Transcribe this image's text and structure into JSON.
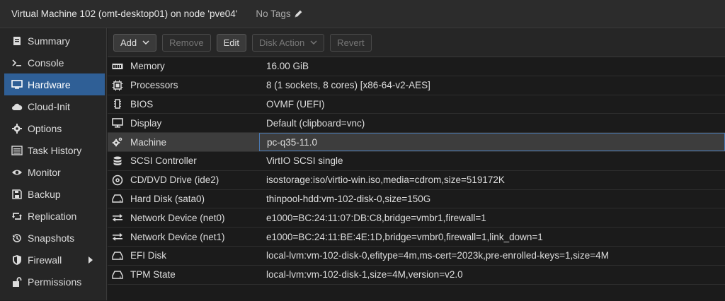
{
  "header": {
    "title": "Virtual Machine 102 (omt-desktop01) on node 'pve04'",
    "tags_label": "No Tags"
  },
  "sidebar": {
    "items": [
      {
        "label": "Summary",
        "icon": "summary-icon"
      },
      {
        "label": "Console",
        "icon": "console-icon"
      },
      {
        "label": "Hardware",
        "icon": "monitor-icon",
        "active": true
      },
      {
        "label": "Cloud-Init",
        "icon": "cloud-icon"
      },
      {
        "label": "Options",
        "icon": "gear-icon"
      },
      {
        "label": "Task History",
        "icon": "list-icon"
      },
      {
        "label": "Monitor",
        "icon": "eye-icon"
      },
      {
        "label": "Backup",
        "icon": "floppy-icon"
      },
      {
        "label": "Replication",
        "icon": "retweet-icon"
      },
      {
        "label": "Snapshots",
        "icon": "history-icon"
      },
      {
        "label": "Firewall",
        "icon": "shield-icon"
      },
      {
        "label": "Permissions",
        "icon": "unlock-icon"
      }
    ]
  },
  "toolbar": {
    "add": "Add",
    "remove": "Remove",
    "edit": "Edit",
    "disk_action": "Disk Action",
    "revert": "Revert"
  },
  "hardware": {
    "rows": [
      {
        "name": "Memory",
        "value": "16.00 GiB",
        "icon": "memory-icon"
      },
      {
        "name": "Processors",
        "value": "8 (1 sockets, 8 cores) [x86-64-v2-AES]",
        "icon": "cpu-icon"
      },
      {
        "name": "BIOS",
        "value": "OVMF (UEFI)",
        "icon": "chip-icon"
      },
      {
        "name": "Display",
        "value": "Default (clipboard=vnc)",
        "icon": "desktop-icon"
      },
      {
        "name": "Machine",
        "value": "pc-q35-11.0",
        "icon": "cogs-icon"
      },
      {
        "name": "SCSI Controller",
        "value": "VirtIO SCSI single",
        "icon": "database-icon"
      },
      {
        "name": "CD/DVD Drive (ide2)",
        "value": "isostorage:iso/virtio-win.iso,media=cdrom,size=519172K",
        "icon": "disc-icon"
      },
      {
        "name": "Hard Disk (sata0)",
        "value": "thinpool-hdd:vm-102-disk-0,size=150G",
        "icon": "hdd-icon"
      },
      {
        "name": "Network Device (net0)",
        "value": "e1000=BC:24:11:07:DB:C8,bridge=vmbr1,firewall=1",
        "icon": "exchange-icon"
      },
      {
        "name": "Network Device (net1)",
        "value": "e1000=BC:24:11:BE:4E:1D,bridge=vmbr0,firewall=1,link_down=1",
        "icon": "exchange-icon"
      },
      {
        "name": "EFI Disk",
        "value": "local-lvm:vm-102-disk-0,efitype=4m,ms-cert=2023k,pre-enrolled-keys=1,size=4M",
        "icon": "hdd-icon"
      },
      {
        "name": "TPM State",
        "value": "local-lvm:vm-102-disk-1,size=4M,version=v2.0",
        "icon": "hdd-icon"
      }
    ],
    "selected_index": 4
  }
}
